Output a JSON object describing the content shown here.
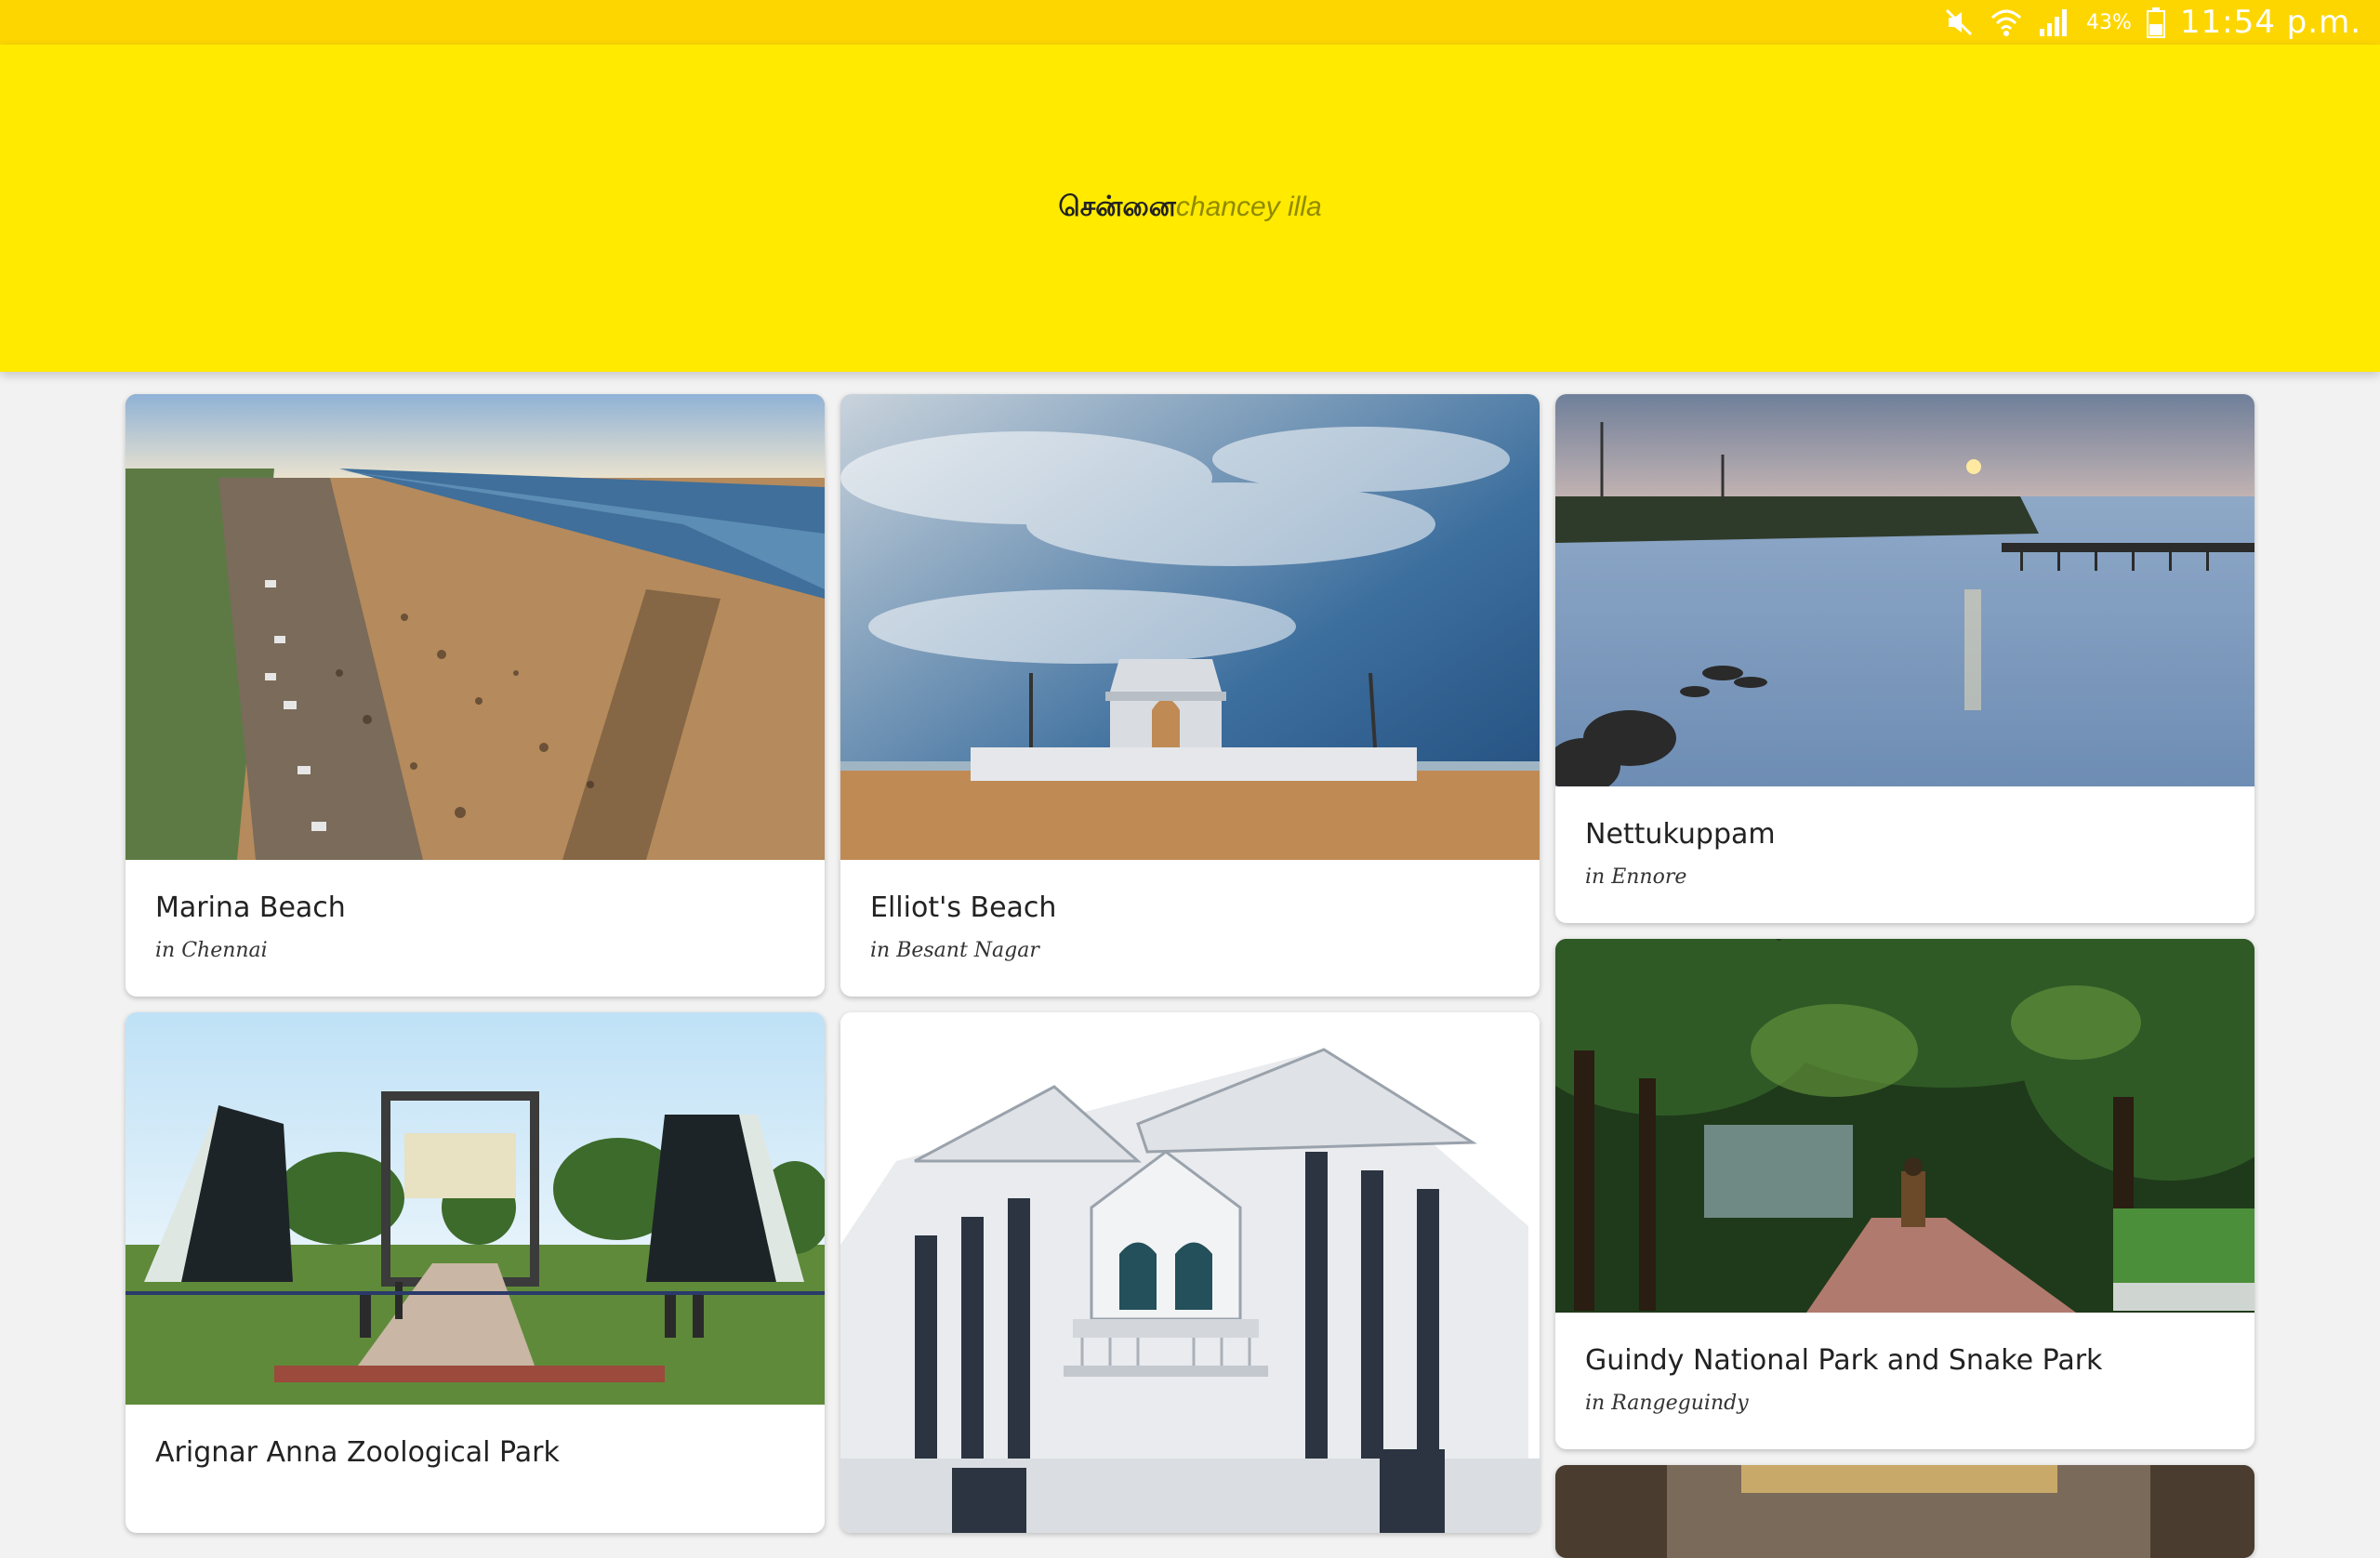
{
  "status_bar": {
    "battery": "43%",
    "time": "11:54 p.m.",
    "icons": [
      "mute-icon",
      "wifi-icon",
      "signal-icon",
      "battery-icon"
    ]
  },
  "header": {
    "title_tamil": "சென்னை",
    "subtitle": "chancey illa"
  },
  "places": [
    {
      "name": "Marina Beach",
      "location": "in Chennai"
    },
    {
      "name": "Elliot's Beach",
      "location": "in Besant Nagar"
    },
    {
      "name": "Nettukuppam",
      "location": "in Ennore"
    },
    {
      "name": "Arignar Anna Zoological Park",
      "location": ""
    },
    {
      "name": "Guindy National Park and Snake Park",
      "location": "in Rangeguindy"
    }
  ],
  "colors": {
    "status_bar": "#fdd600",
    "header": "#ffea00",
    "background": "#f2f2f2"
  }
}
